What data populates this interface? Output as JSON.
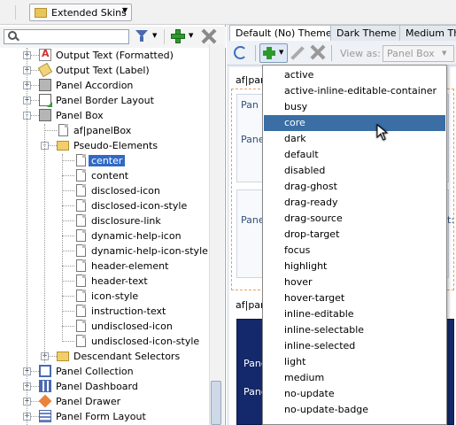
{
  "toolbar": {
    "skins_label": "Extended Skins"
  },
  "search": {
    "placeholder": "",
    "value": ""
  },
  "tree": [
    {
      "label": "Output Text (Formatted)",
      "icon": "output-text-formatted-icon",
      "indent": 1,
      "expander": "+",
      "selected": false
    },
    {
      "label": "Output Text (Label)",
      "icon": "output-label-icon",
      "indent": 1,
      "expander": "+",
      "selected": false
    },
    {
      "label": "Panel Accordion",
      "icon": "panel-icon",
      "indent": 1,
      "expander": "+",
      "selected": false
    },
    {
      "label": "Panel Border Layout",
      "icon": "panel-border-icon",
      "indent": 1,
      "expander": "+",
      "selected": false
    },
    {
      "label": "Panel Box",
      "icon": "panel-icon",
      "indent": 1,
      "expander": "-",
      "selected": false
    },
    {
      "label": "af|panelBox",
      "icon": "page-icon",
      "indent": 2,
      "expander": "",
      "selected": false
    },
    {
      "label": "Pseudo-Elements",
      "icon": "folder-open-icon",
      "indent": 2,
      "expander": "-",
      "selected": false
    },
    {
      "label": "center",
      "icon": "page-icon",
      "indent": 3,
      "expander": "",
      "selected": true
    },
    {
      "label": "content",
      "icon": "page-icon",
      "indent": 3,
      "expander": "",
      "selected": false
    },
    {
      "label": "disclosed-icon",
      "icon": "page-icon",
      "indent": 3,
      "expander": "",
      "selected": false
    },
    {
      "label": "disclosed-icon-style",
      "icon": "page-icon",
      "indent": 3,
      "expander": "",
      "selected": false
    },
    {
      "label": "disclosure-link",
      "icon": "page-icon",
      "indent": 3,
      "expander": "",
      "selected": false
    },
    {
      "label": "dynamic-help-icon",
      "icon": "page-icon",
      "indent": 3,
      "expander": "",
      "selected": false
    },
    {
      "label": "dynamic-help-icon-style",
      "icon": "page-icon",
      "indent": 3,
      "expander": "",
      "selected": false
    },
    {
      "label": "header-element",
      "icon": "page-icon",
      "indent": 3,
      "expander": "",
      "selected": false
    },
    {
      "label": "header-text",
      "icon": "page-icon",
      "indent": 3,
      "expander": "",
      "selected": false
    },
    {
      "label": "icon-style",
      "icon": "page-icon",
      "indent": 3,
      "expander": "",
      "selected": false
    },
    {
      "label": "instruction-text",
      "icon": "page-icon",
      "indent": 3,
      "expander": "",
      "selected": false
    },
    {
      "label": "undisclosed-icon",
      "icon": "page-icon",
      "indent": 3,
      "expander": "",
      "selected": false
    },
    {
      "label": "undisclosed-icon-style",
      "icon": "page-icon",
      "indent": 3,
      "expander": "",
      "selected": false
    },
    {
      "label": "Descendant Selectors",
      "icon": "folder-icon",
      "indent": 2,
      "expander": "+",
      "selected": false
    },
    {
      "label": "Panel Collection",
      "icon": "panel-collection-icon",
      "indent": 1,
      "expander": "+",
      "selected": false
    },
    {
      "label": "Panel Dashboard",
      "icon": "panel-dashboard-icon",
      "indent": 1,
      "expander": "+",
      "selected": false
    },
    {
      "label": "Panel Drawer",
      "icon": "panel-drawer-icon",
      "indent": 1,
      "expander": "+",
      "selected": false
    },
    {
      "label": "Panel Form Layout",
      "icon": "panel-form-icon",
      "indent": 1,
      "expander": "+",
      "selected": false
    }
  ],
  "tabs": [
    {
      "label": "Default (No) Theme",
      "active": true
    },
    {
      "label": "Dark Theme",
      "active": false
    },
    {
      "label": "Medium The",
      "active": false
    }
  ],
  "right_toolbar": {
    "view_as_label": "View as:",
    "view_as_value": "Panel Box"
  },
  "canvas": {
    "section1_label": "af|pan",
    "section2_label": "af|pan",
    "row_label": "Pane",
    "row_label_short": "Pan",
    "right_fragment": "t:"
  },
  "menu_items": [
    "active",
    "active-inline-editable-container",
    "busy",
    "core",
    "dark",
    "default",
    "disabled",
    "drag-ghost",
    "drag-ready",
    "drag-source",
    "drop-target",
    "focus",
    "highlight",
    "hover",
    "hover-target",
    "inline-editable",
    "inline-selectable",
    "inline-selected",
    "light",
    "medium",
    "no-update",
    "no-update-badge"
  ],
  "menu_highlighted": "core",
  "colors": {
    "selection": "#316ac5",
    "menu_highlight": "#3a6ea5",
    "dark_panel": "#14296b",
    "dashed_border": "#e8a060"
  }
}
